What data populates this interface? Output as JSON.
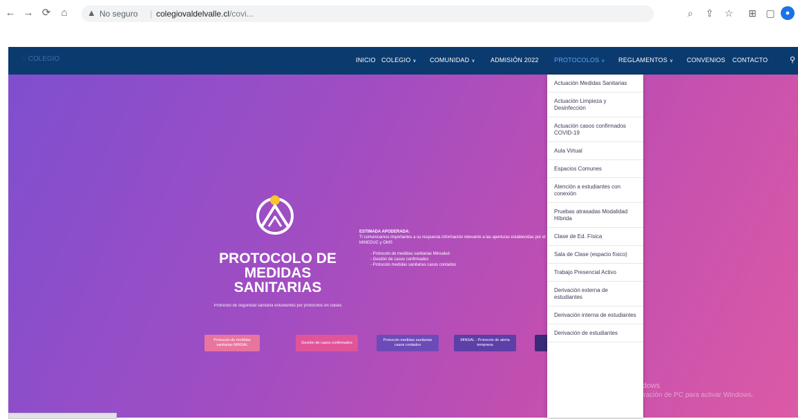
{
  "browser": {
    "security_label": "No seguro",
    "host": "colegiovaldelvalle.cl",
    "path": "/covi..."
  },
  "site": {
    "logo_text": "COLEGIO",
    "nav": [
      {
        "label": "INICIO"
      },
      {
        "label": "COLEGIO"
      },
      {
        "label": "COMUNIDAD"
      },
      {
        "label": "ADMISIÓN 2022"
      },
      {
        "label": "PROTOCOLOS"
      },
      {
        "label": "REGLAMENTOS"
      },
      {
        "label": "CONVENIOS"
      },
      {
        "label": "CONTACTO"
      }
    ]
  },
  "hero": {
    "title": "PROTOCOLO DE MEDIDAS SANITARIAS",
    "subtitle": "Protocolo de seguridad sanitaria estudiantes por protocolos en clases",
    "text_heading": "ESTIMADA APODERADA:",
    "text_body": "Ti comunicamos importantes a su respuesta información relevante a las aperturas establecidas por el MINEDUC y OMS",
    "list": [
      "Protocolo de medidas sanitarias Minsalud",
      "Gestión de casos confirmados",
      "Protocolo medidas sanitarias casos contados"
    ],
    "buttons": [
      "Protocolo de medidas sanitarias MINSAL",
      "Gestión de casos confirmados",
      "Protocolo medidas sanitarias casos contados",
      "MINSAL - Protocolo de alerta temprana",
      ""
    ]
  },
  "dropdown": {
    "items": [
      "Actuación Medidas Sanitarias",
      "Actuación Limpieza y Desinfección",
      "Actuación casos confirmados COVID-19",
      "Aula Virtual",
      "Espacios Comunes",
      "Atención a estudiantes con conexión",
      "Pruebas atrasadas Modalidad Híbrida",
      "Clase de Ed. Física",
      "Sala de Clase (espacio físico)",
      "Trabajo Presencial Activo",
      "Derivación externa de estudiantes",
      "Derivación interna de estudiantes",
      "Derivación de estudiantes"
    ]
  },
  "watermark": {
    "line1": "Activar Windows",
    "line2": "Ve a Configuración de PC para activar Windows."
  },
  "colors": {
    "nav_bg": "#0b3a6e",
    "nav_active": "#5aa7ff",
    "hero_start": "#7f4fcf",
    "hero_end": "#dc5aa6",
    "accent_yellow": "#f7c531"
  }
}
